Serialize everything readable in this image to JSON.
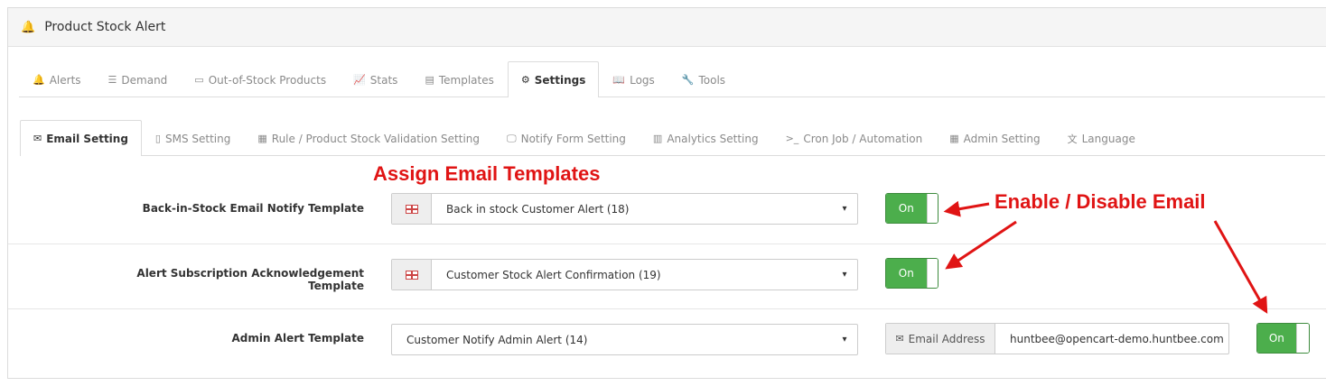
{
  "panel": {
    "title": "Product Stock Alert",
    "icon": "bell-icon"
  },
  "main_tabs": [
    {
      "label": "Alerts",
      "icon": "bell-icon",
      "glyph": "🔔"
    },
    {
      "label": "Demand",
      "icon": "list-icon",
      "glyph": "☰"
    },
    {
      "label": "Out-of-Stock Products",
      "icon": "battery-empty-icon",
      "glyph": "▭"
    },
    {
      "label": "Stats",
      "icon": "line-chart-icon",
      "glyph": "📈"
    },
    {
      "label": "Templates",
      "icon": "list-alt-icon",
      "glyph": "▤"
    },
    {
      "label": "Settings",
      "icon": "cog-icon",
      "glyph": "⚙",
      "active": true
    },
    {
      "label": "Logs",
      "icon": "book-icon",
      "glyph": "📖"
    },
    {
      "label": "Tools",
      "icon": "wrench-icon",
      "glyph": "🔧"
    }
  ],
  "sub_tabs": [
    {
      "label": "Email Setting",
      "icon": "envelope-icon",
      "glyph": "✉",
      "active": true
    },
    {
      "label": "SMS Setting",
      "icon": "mobile-icon",
      "glyph": "▯"
    },
    {
      "label": "Rule / Product Stock Validation Setting",
      "icon": "calculator-icon",
      "glyph": "▦"
    },
    {
      "label": "Notify Form Setting",
      "icon": "desktop-icon",
      "glyph": "🖵"
    },
    {
      "label": "Analytics Setting",
      "icon": "bar-chart-icon",
      "glyph": "▥"
    },
    {
      "label": "Cron Job / Automation",
      "icon": "terminal-icon",
      "glyph": ">_"
    },
    {
      "label": "Admin Setting",
      "icon": "table-icon",
      "glyph": "▦"
    },
    {
      "label": "Language",
      "icon": "language-icon",
      "glyph": "文"
    }
  ],
  "rows": {
    "back_in_stock": {
      "label": "Back-in-Stock Email Notify Template",
      "selected": "Back in stock Customer Alert (18)",
      "toggle": "On"
    },
    "acknowledgement": {
      "label": "Alert Subscription Acknowledgement Template",
      "selected": "Customer Stock Alert Confirmation (19)",
      "toggle": "On"
    },
    "admin": {
      "label": "Admin Alert Template",
      "selected": "Customer Notify Admin Alert (14)",
      "email_addon": "Email Address",
      "email_value": "huntbee@opencart-demo.huntbee.com",
      "toggle": "On"
    }
  },
  "annotations": {
    "assign": "Assign Email Templates",
    "enable": "Enable / Disable Email"
  },
  "colors": {
    "toggle_on": "#4cae4c",
    "annotation": "#e01414"
  }
}
